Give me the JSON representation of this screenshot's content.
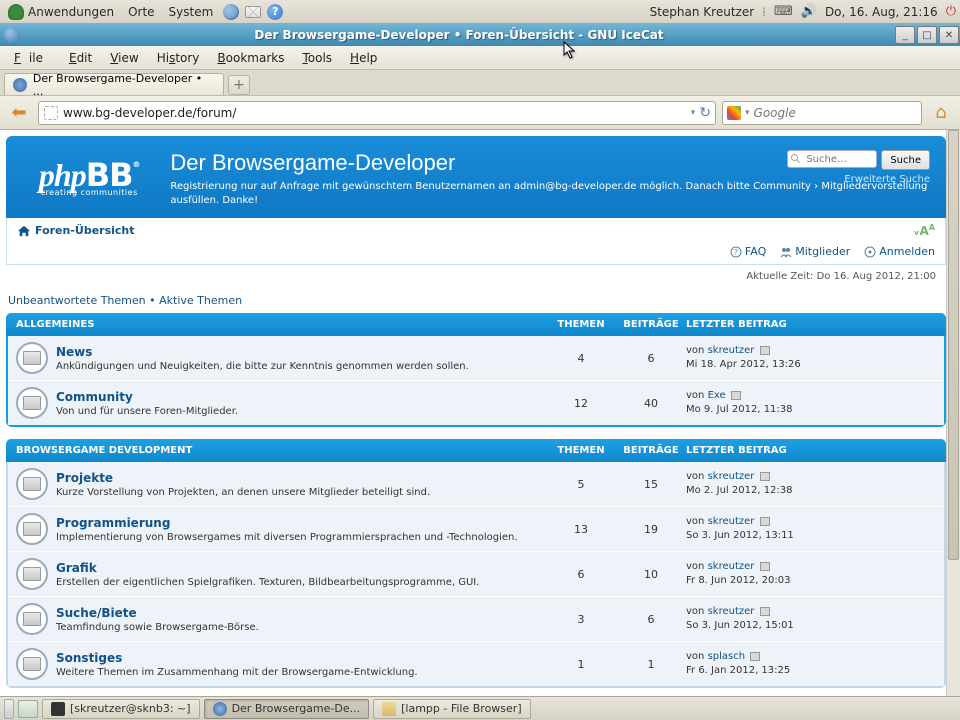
{
  "gnome": {
    "apps": "Anwendungen",
    "places": "Orte",
    "system": "System",
    "user": "Stephan Kreutzer",
    "datetime": "Do, 16. Aug, 21:16"
  },
  "window": {
    "title": "Der Browsergame-Developer • Foren-Übersicht - GNU IceCat"
  },
  "menu": {
    "file": "File",
    "edit": "Edit",
    "view": "View",
    "history": "History",
    "bookmarks": "Bookmarks",
    "tools": "Tools",
    "help": "Help"
  },
  "tab": {
    "label": "Der Browsergame-Developer • ..."
  },
  "url": {
    "value": "www.bg-developer.de/forum/"
  },
  "search": {
    "placeholder": "Google"
  },
  "site": {
    "logo_main": "phpBB",
    "logo_tag": "creating  communities",
    "title": "Der Browsergame-Developer",
    "subtitle": "Registrierung nur auf Anfrage mit gewünschtem Benutzernamen an admin@bg-developer.de möglich. Danach bitte Community › Mitgliedervorstellung ausfüllen. Danke!",
    "search_placeholder": "Suche…",
    "search_btn": "Suche",
    "adv_search": "Erweiterte Suche",
    "breadcrumb": "Foren-Übersicht",
    "faq": "FAQ",
    "members": "Mitglieder",
    "login": "Anmelden",
    "current_time": "Aktuelle Zeit: Do 16. Aug 2012, 21:00",
    "unanswered": "Unbeantwortete Themen",
    "active": "Aktive Themen"
  },
  "headers": {
    "topics": "THEMEN",
    "posts": "BEITRÄGE",
    "last": "LETZTER BEITRAG"
  },
  "by": "von",
  "cats": [
    {
      "name": "ALLGEMEINES",
      "forums": [
        {
          "title": "News",
          "desc": "Ankündigungen und Neuigkeiten, die bitte zur Kenntnis genommen werden sollen.",
          "t": "4",
          "p": "6",
          "by": "skreutzer",
          "when": "Mi 18. Apr 2012, 13:26"
        },
        {
          "title": "Community",
          "desc": "Von und für unsere Foren-Mitglieder.",
          "t": "12",
          "p": "40",
          "by": "Exe",
          "when": "Mo 9. Jul 2012, 11:38"
        }
      ]
    },
    {
      "name": "BROWSERGAME DEVELOPMENT",
      "forums": [
        {
          "title": "Projekte",
          "desc": "Kurze Vorstellung von Projekten, an denen unsere Mitglieder beteiligt sind.",
          "t": "5",
          "p": "15",
          "by": "skreutzer",
          "when": "Mo 2. Jul 2012, 12:38"
        },
        {
          "title": "Programmierung",
          "desc": "Implementierung von Browsergames mit diversen Programmiersprachen und -Technologien.",
          "t": "13",
          "p": "19",
          "by": "skreutzer",
          "when": "So 3. Jun 2012, 13:11"
        },
        {
          "title": "Grafik",
          "desc": "Erstellen der eigentlichen Spielgrafiken. Texturen, Bildbearbeitungsprogramme, GUI.",
          "t": "6",
          "p": "10",
          "by": "skreutzer",
          "when": "Fr 8. Jun 2012, 20:03"
        },
        {
          "title": "Suche/Biete",
          "desc": "Teamfindung sowie Browsergame-Börse.",
          "t": "3",
          "p": "6",
          "by": "skreutzer",
          "when": "So 3. Jun 2012, 15:01"
        },
        {
          "title": "Sonstiges",
          "desc": "Weitere Themen im Zusammenhang mit der Browsergame-Entwicklung.",
          "t": "1",
          "p": "1",
          "by": "splasch",
          "when": "Fr 6. Jan 2012, 13:25"
        }
      ]
    }
  ],
  "taskbar": {
    "t1": "[skreutzer@sknb3: ~]",
    "t2": "Der Browsergame-De...",
    "t3": "[lampp - File Browser]"
  }
}
